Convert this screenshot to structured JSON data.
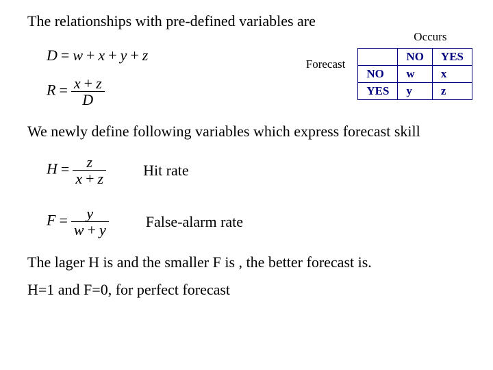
{
  "text": {
    "intro": "The relationships with pre-defined  variables are",
    "occurs": "Occurs",
    "forecast": "Forecast",
    "newly": "We newly define following variables which express forecast skill",
    "hit": "Hit rate",
    "false_alarm": "False-alarm rate",
    "better": "The lager H is  and  the smaller F is , the  better forecast is.",
    "perfect": "H=1 and F=0, for perfect forecast"
  },
  "table": {
    "col1": "NO",
    "col2": "YES",
    "row1": "NO",
    "row2": "YES",
    "c11": "w",
    "c12": "x",
    "c21": "y",
    "c22": "z"
  },
  "eq": {
    "D_lhs": "D",
    "D_rhs_w": "w",
    "D_rhs_x": "x",
    "D_rhs_y": "y",
    "D_rhs_z": "z",
    "R_lhs": "R",
    "R_num_x": "x",
    "R_num_z": "z",
    "R_den": "D",
    "H_lhs": "H",
    "H_num": "z",
    "H_den_x": "x",
    "H_den_z": "z",
    "F_lhs": "F",
    "F_num": "y",
    "F_den_w": "w",
    "F_den_y": "y"
  }
}
